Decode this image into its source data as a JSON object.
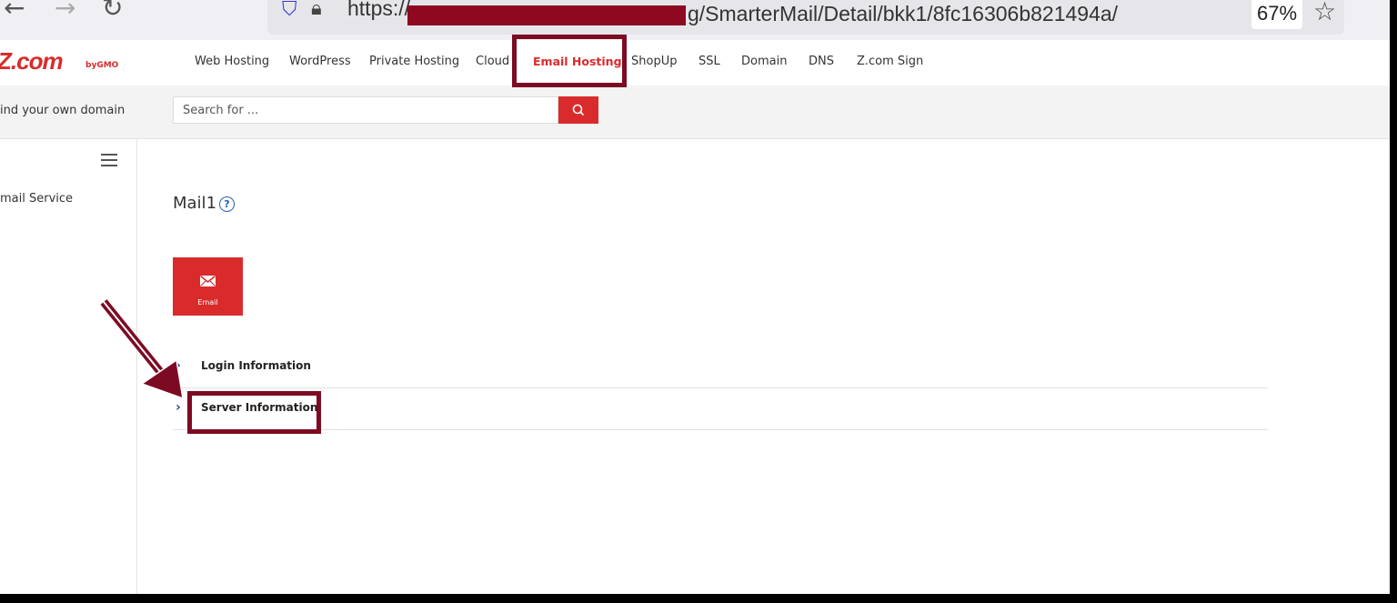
{
  "browser": {
    "back_icon": "arrow-left-icon",
    "forward_icon": "arrow-right-icon",
    "reload_icon": "reload-icon",
    "url_prefix": "https://",
    "url_suffix": "g/SmarterMail/Detail/bkk1/8fc16306b821494a/",
    "zoom": "67%"
  },
  "site": {
    "logo": "Z.com",
    "logo_sub": "by GMO",
    "nav": [
      {
        "label": "Web Hosting"
      },
      {
        "label": "WordPress"
      },
      {
        "label": "Private Hosting"
      },
      {
        "label": "Cloud"
      },
      {
        "label": "Email Hosting"
      },
      {
        "label": "ShopUp"
      },
      {
        "label": "SSL"
      },
      {
        "label": "Domain"
      },
      {
        "label": "DNS"
      },
      {
        "label": "Z.com Sign"
      }
    ],
    "active_nav": "Email Hosting",
    "brand_color": "#d92b2b"
  },
  "search": {
    "find_label": "ind your own domain",
    "placeholder": "Search for ...",
    "button_icon": "search-icon"
  },
  "sidebar": {
    "menu_icon": "hamburger-icon",
    "items": [
      {
        "label": "mail Service"
      }
    ]
  },
  "main": {
    "title": "Mail1",
    "help_icon": "question-circle-icon",
    "tile": {
      "label": "Email",
      "icon": "envelope-icon"
    },
    "sections": [
      {
        "label": "Login Information"
      },
      {
        "label": "Server Information"
      }
    ]
  },
  "annotation_color": "#7d0a23"
}
